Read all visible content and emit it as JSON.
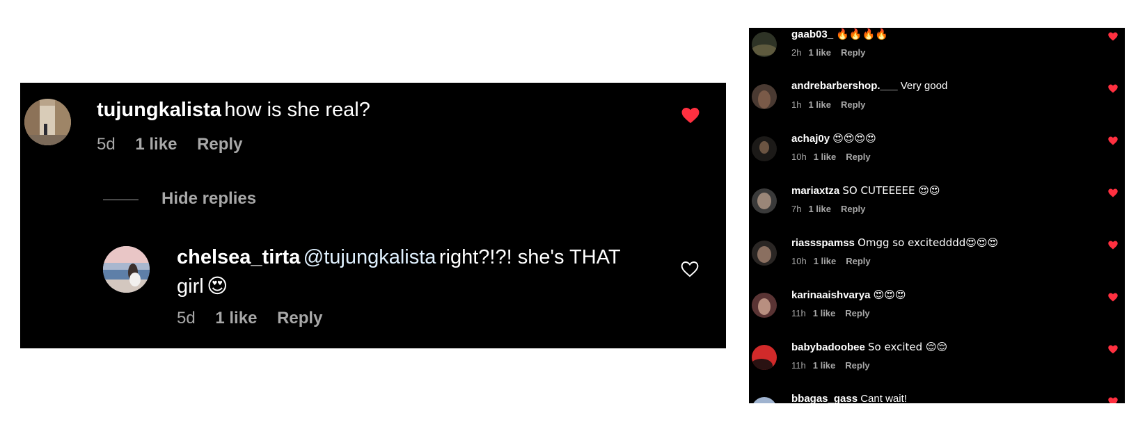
{
  "left": {
    "comment": {
      "username": "tujungkalista",
      "text": "how is she real?",
      "time": "5d",
      "likes": "1 like",
      "reply": "Reply",
      "liked": true
    },
    "hide_replies": "Hide replies",
    "reply_comment": {
      "username": "chelsea_tirta",
      "mention": "@tujungkalista",
      "text_line1": "right?!?! she's THAT",
      "text_line2": "girl",
      "emoji": "😍",
      "time": "5d",
      "likes": "1 like",
      "reply": "Reply",
      "liked": false
    }
  },
  "right": {
    "comments": [
      {
        "username": "gaab03_",
        "text": "🔥🔥🔥🔥",
        "time": "2h",
        "likes": "1 like",
        "reply": "Reply"
      },
      {
        "username": "andrebarbershop.___",
        "text": "Very good",
        "time": "1h",
        "likes": "1 like",
        "reply": "Reply"
      },
      {
        "username": "achaj0y",
        "text": "😍😍😍😍",
        "time": "10h",
        "likes": "1 like",
        "reply": "Reply"
      },
      {
        "username": "mariaxtza",
        "text": "SO CUTEEEEE 😍😍",
        "time": "7h",
        "likes": "1 like",
        "reply": "Reply"
      },
      {
        "username": "riassspamss",
        "text": "Omgg so excitedddd😍😍😍",
        "time": "10h",
        "likes": "1 like",
        "reply": "Reply"
      },
      {
        "username": "karinaaishvarya",
        "text": "😍😍😍",
        "time": "11h",
        "likes": "1 like",
        "reply": "Reply"
      },
      {
        "username": "babybadoobee",
        "text": "So excited 😌😌",
        "time": "11h",
        "likes": "1 like",
        "reply": "Reply"
      },
      {
        "username": "bbagas_gass",
        "text": "Cant wait!",
        "time": "",
        "likes": "",
        "reply": ""
      }
    ]
  },
  "colors": {
    "background": "#000000",
    "heart_liked": "#ff3040",
    "meta_text": "#a8a8a8",
    "mention": "#e0f1ff"
  }
}
